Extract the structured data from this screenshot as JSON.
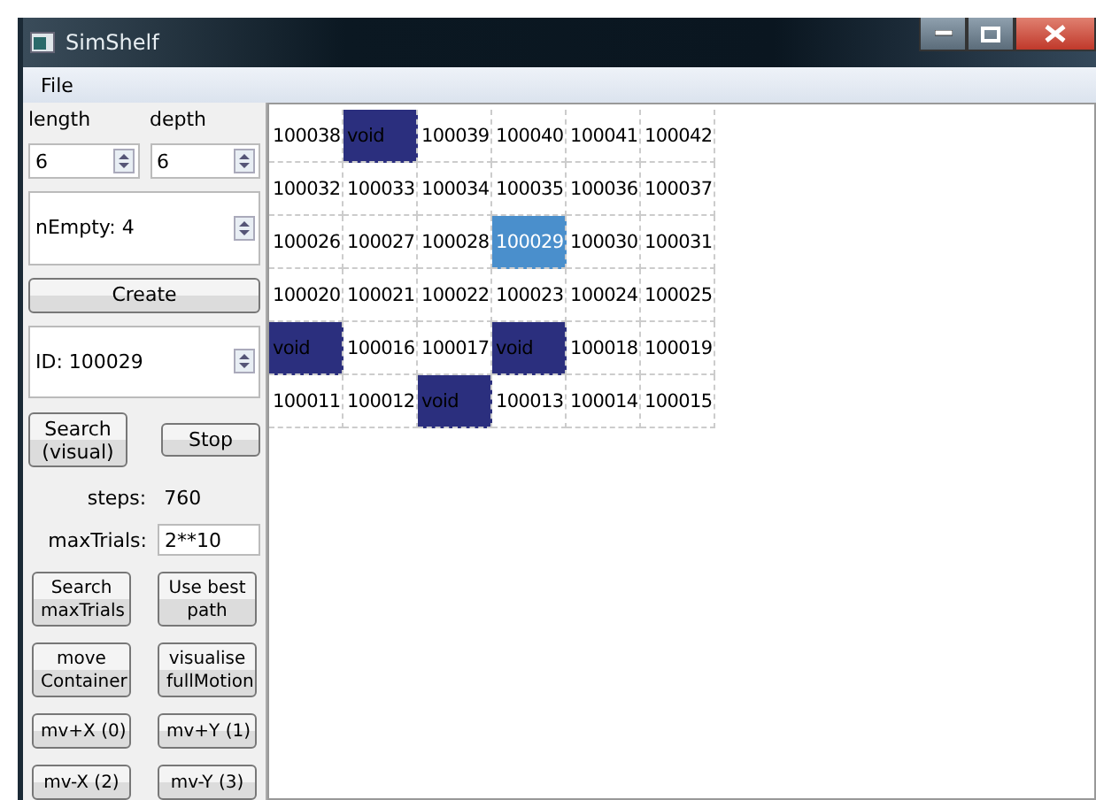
{
  "window": {
    "title": "SimShelf"
  },
  "menu": [
    "File"
  ],
  "panel": {
    "length_label": "length",
    "depth_label": "depth",
    "length_value": "6",
    "depth_value": "6",
    "n_empty": "nEmpty: 4",
    "create_button": "Create",
    "id_value": "ID: 100029",
    "search_button": "Search\n(visual)",
    "stop_button": "Stop",
    "steps_label": "steps:",
    "steps_value": "760",
    "max_trials_label": "maxTrials:",
    "max_trials_value": "2**10",
    "button_pairs": [
      [
        "Search\nmaxTrials",
        "Use best\npath"
      ],
      [
        "move\nContainer",
        "visualise\nfullMotion"
      ],
      [
        "mv+X (0)",
        "mv+Y (1)"
      ],
      [
        "mv-X (2)",
        "mv-Y (3)"
      ]
    ]
  },
  "grid": [
    [
      {
        "text": "100038",
        "kind": "slot",
        "selected": false
      },
      {
        "text": "void",
        "kind": "void",
        "selected": false
      },
      {
        "text": "100039",
        "kind": "slot",
        "selected": false
      },
      {
        "text": "100040",
        "kind": "slot",
        "selected": false
      },
      {
        "text": "100041",
        "kind": "slot",
        "selected": false
      },
      {
        "text": "100042",
        "kind": "slot",
        "selected": false
      }
    ],
    [
      {
        "text": "100032",
        "kind": "slot",
        "selected": false
      },
      {
        "text": "100033",
        "kind": "slot",
        "selected": false
      },
      {
        "text": "100034",
        "kind": "slot",
        "selected": false
      },
      {
        "text": "100035",
        "kind": "slot",
        "selected": false
      },
      {
        "text": "100036",
        "kind": "slot",
        "selected": false
      },
      {
        "text": "100037",
        "kind": "slot",
        "selected": false
      }
    ],
    [
      {
        "text": "100026",
        "kind": "slot",
        "selected": false
      },
      {
        "text": "100027",
        "kind": "slot",
        "selected": false
      },
      {
        "text": "100028",
        "kind": "slot",
        "selected": false
      },
      {
        "text": "100029",
        "kind": "slot",
        "selected": true
      },
      {
        "text": "100030",
        "kind": "slot",
        "selected": false
      },
      {
        "text": "100031",
        "kind": "slot",
        "selected": false
      }
    ],
    [
      {
        "text": "100020",
        "kind": "slot",
        "selected": false
      },
      {
        "text": "100021",
        "kind": "slot",
        "selected": false
      },
      {
        "text": "100022",
        "kind": "slot",
        "selected": false
      },
      {
        "text": "100023",
        "kind": "slot",
        "selected": false
      },
      {
        "text": "100024",
        "kind": "slot",
        "selected": false
      },
      {
        "text": "100025",
        "kind": "slot",
        "selected": false
      }
    ],
    [
      {
        "text": "void",
        "kind": "void",
        "selected": false
      },
      {
        "text": "100016",
        "kind": "slot",
        "selected": false
      },
      {
        "text": "100017",
        "kind": "slot",
        "selected": false
      },
      {
        "text": "void",
        "kind": "void",
        "selected": false
      },
      {
        "text": "100018",
        "kind": "slot",
        "selected": false
      },
      {
        "text": "100019",
        "kind": "slot",
        "selected": false
      }
    ],
    [
      {
        "text": "100011",
        "kind": "slot",
        "selected": false
      },
      {
        "text": "100012",
        "kind": "slot",
        "selected": false
      },
      {
        "text": "void",
        "kind": "void",
        "selected": false
      },
      {
        "text": "100013",
        "kind": "slot",
        "selected": false
      },
      {
        "text": "100014",
        "kind": "slot",
        "selected": false
      },
      {
        "text": "100015",
        "kind": "slot",
        "selected": false
      }
    ]
  ]
}
